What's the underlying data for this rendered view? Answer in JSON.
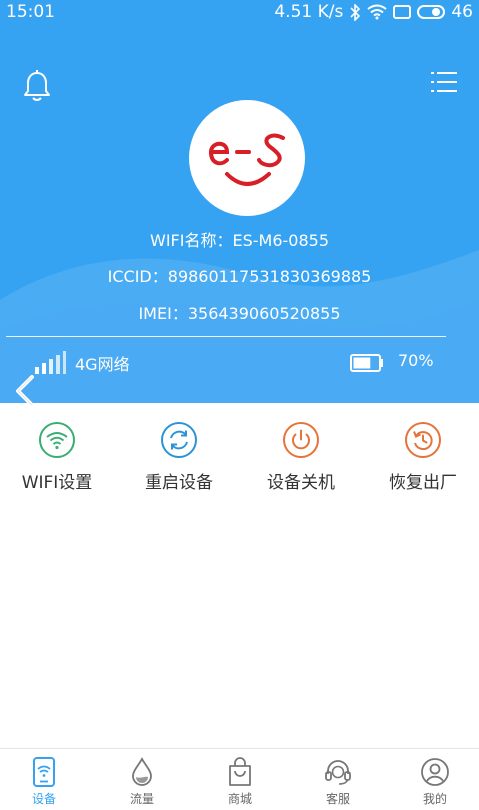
{
  "status_bar": {
    "time": "15:01",
    "speed": "4.51 K/s",
    "network_type": "46"
  },
  "device": {
    "wifi_name_label": "WIFI名称",
    "wifi_name": "ES-M6-0855",
    "iccid_label": "ICCID",
    "iccid": "89860117531830369885",
    "imei_label": "IMEI",
    "imei": "356439060520855",
    "network": "4G网络",
    "battery": "70%",
    "battery_level": 0.7
  },
  "actions": [
    {
      "label": "WIFI设置",
      "icon": "wifi-icon",
      "color": "#3aae72"
    },
    {
      "label": "重启设备",
      "icon": "restart-icon",
      "color": "#2b94d6"
    },
    {
      "label": "设备关机",
      "icon": "power-icon",
      "color": "#e5733a"
    },
    {
      "label": "恢复出厂",
      "icon": "reset-icon",
      "color": "#e5733a"
    }
  ],
  "tabs": [
    {
      "label": "设备",
      "icon": "device-icon",
      "active": true
    },
    {
      "label": "流量",
      "icon": "traffic-icon",
      "active": false
    },
    {
      "label": "商城",
      "icon": "shop-icon",
      "active": false
    },
    {
      "label": "客服",
      "icon": "service-icon",
      "active": false
    },
    {
      "label": "我的",
      "icon": "profile-icon",
      "active": false
    }
  ],
  "colors": {
    "header_bg": "#36a3f2",
    "tab_active": "#36a3f2",
    "logo_red": "#d81e27"
  }
}
